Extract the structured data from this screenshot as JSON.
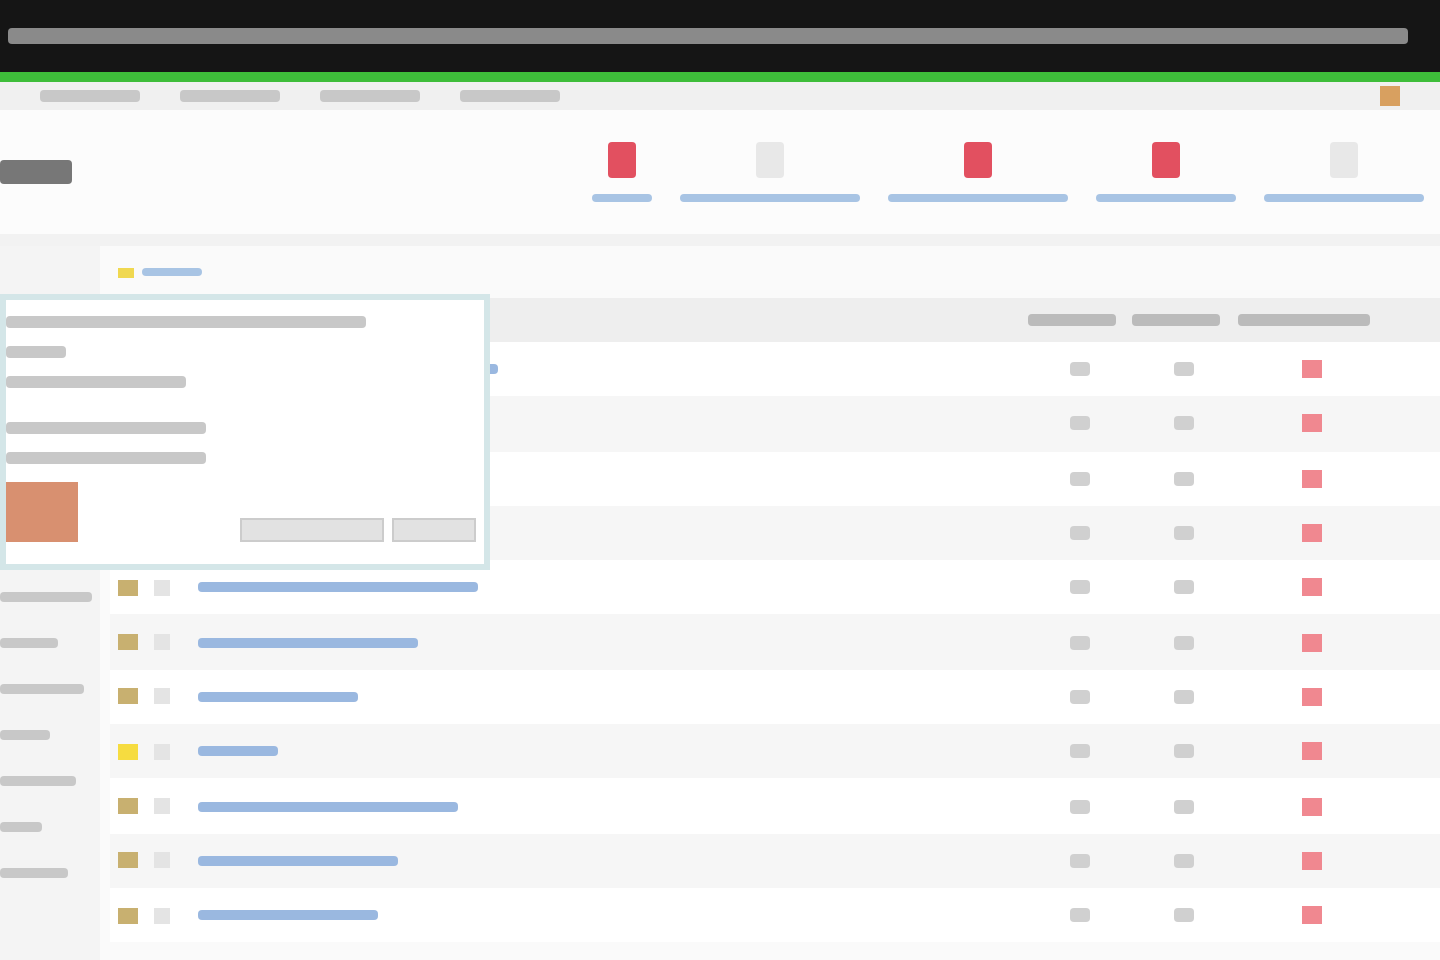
{
  "title_bar": {
    "kind": "dark"
  },
  "menu": [
    {
      "kind": "text"
    },
    {
      "kind": "text"
    },
    {
      "kind": "text"
    },
    {
      "kind": "text"
    }
  ],
  "toolbar": [
    {
      "enabled": true
    },
    {
      "enabled": false
    },
    {
      "enabled": true
    },
    {
      "enabled": true
    },
    {
      "enabled": false
    }
  ],
  "tooltip": {
    "visible": true
  },
  "rows": [
    {
      "published": false
    },
    {
      "published": false
    },
    {
      "published": false
    },
    {
      "published": false
    },
    {
      "highlighted": false,
      "checked": false,
      "published": false
    },
    {
      "highlighted": false,
      "checked": false,
      "published": false
    },
    {
      "highlighted": false,
      "checked": false,
      "published": false
    },
    {
      "highlighted": true,
      "checked": false,
      "published": false
    },
    {
      "highlighted": false,
      "checked": false,
      "published": false
    },
    {
      "highlighted": false,
      "checked": false,
      "published": false
    },
    {
      "highlighted": false,
      "checked": false,
      "published": false
    }
  ]
}
